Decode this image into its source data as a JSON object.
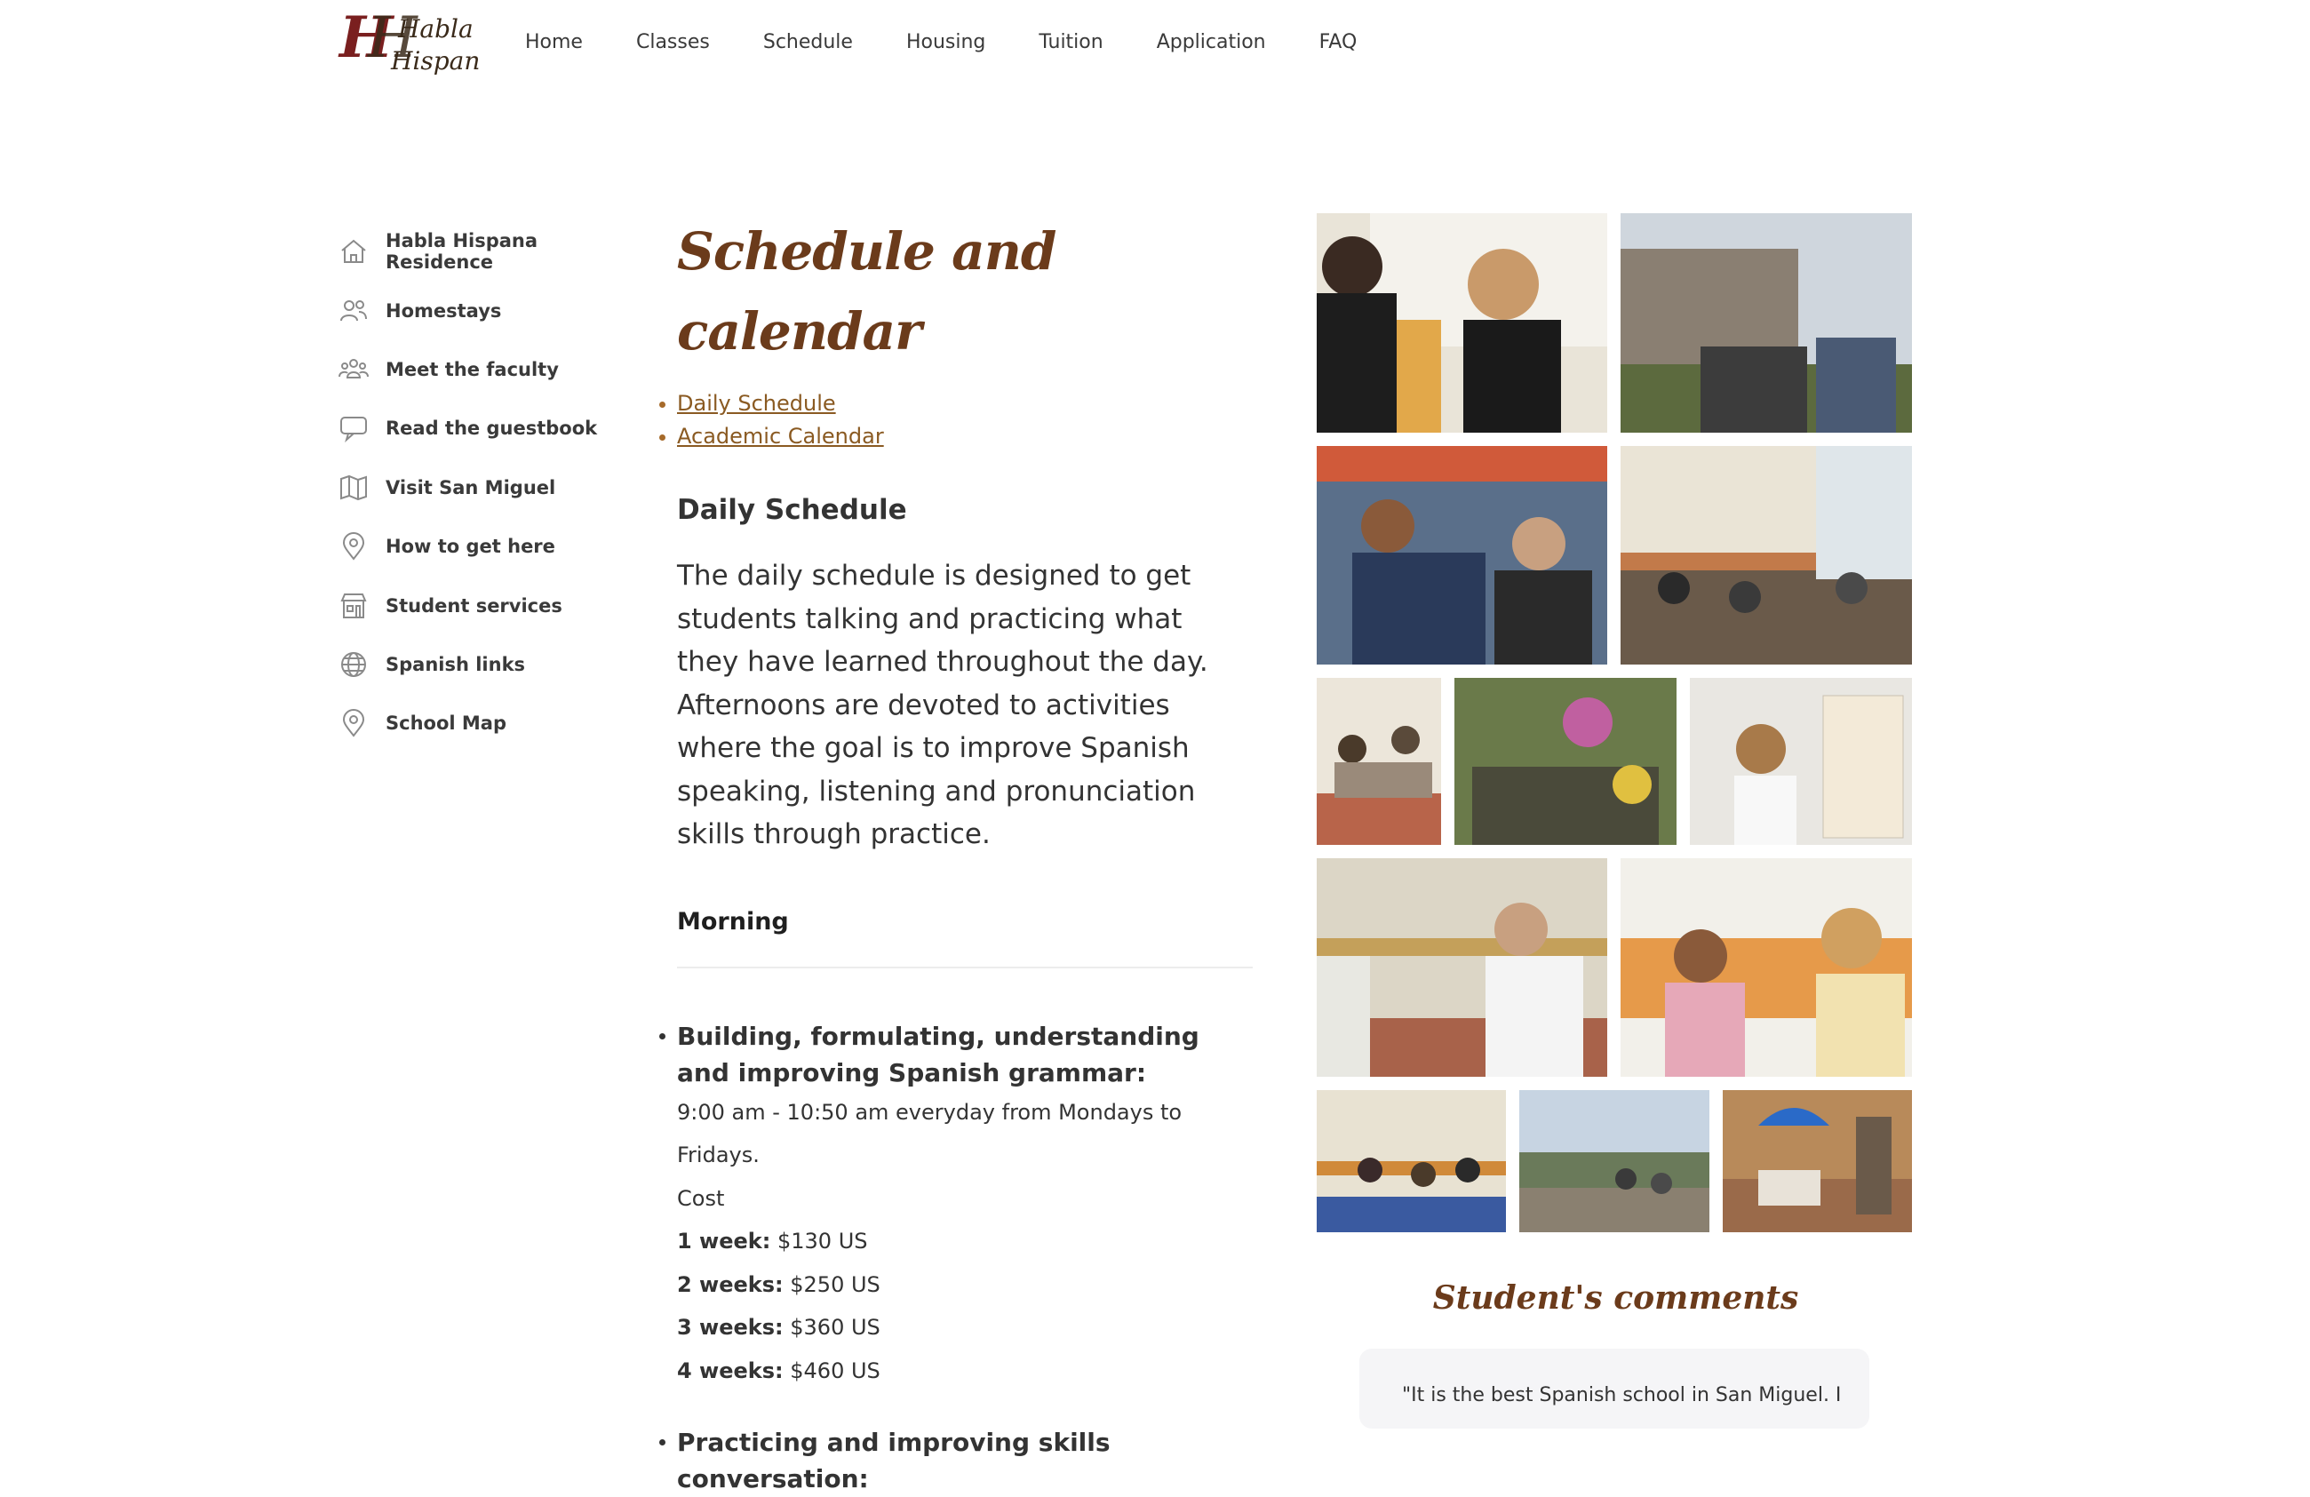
{
  "header": {
    "logo_line1": "Habla",
    "logo_line2": "Hispana",
    "nav": [
      "Home",
      "Classes",
      "Schedule",
      "Housing",
      "Tuition",
      "Application",
      "FAQ"
    ]
  },
  "sidebar": {
    "items": [
      {
        "label": "Habla Hispana Residence",
        "icon": "home-icon"
      },
      {
        "label": "Homestays",
        "icon": "people-icon"
      },
      {
        "label": "Meet the faculty",
        "icon": "group-icon"
      },
      {
        "label": "Read the guestbook",
        "icon": "chat-bubble-icon"
      },
      {
        "label": "Visit San Miguel",
        "icon": "map-icon"
      },
      {
        "label": "How to get here",
        "icon": "location-pin-icon"
      },
      {
        "label": "Student services",
        "icon": "building-icon"
      },
      {
        "label": "Spanish links",
        "icon": "globe-icon"
      },
      {
        "label": "School Map",
        "icon": "location-pin-icon"
      }
    ]
  },
  "main": {
    "title": "Schedule and calendar",
    "toc": [
      "Daily Schedule",
      "Academic Calendar"
    ],
    "daily_heading": "Daily Schedule",
    "intro": "The daily schedule is designed to get students talking and practicing what they have learned throughout the day. Afternoons are devoted to activities where the goal is to improve Spanish speaking, listening and pronunciation skills through practice.",
    "morning_heading": "Morning",
    "grammar": {
      "title": "Building, formulating, understanding and improving Spanish grammar:",
      "time": "9:00 am - 10:50 am everyday from Mondays to Fridays.",
      "cost_label": "Cost",
      "prices": [
        {
          "term": "1 week:",
          "price": "$130 US"
        },
        {
          "term": "2 weeks:",
          "price": "$250 US"
        },
        {
          "term": "3 weeks:",
          "price": "$360 US"
        },
        {
          "term": "4 weeks:",
          "price": "$460 US"
        }
      ]
    },
    "conversation_title": "Practicing and improving skills conversation:"
  },
  "comments": {
    "title": "Student's comments",
    "first_quote": "\"It is the best Spanish school in San Miguel. I"
  },
  "colors": {
    "accent_brown": "#6b3b1b",
    "link_brown": "#8a5a22"
  }
}
